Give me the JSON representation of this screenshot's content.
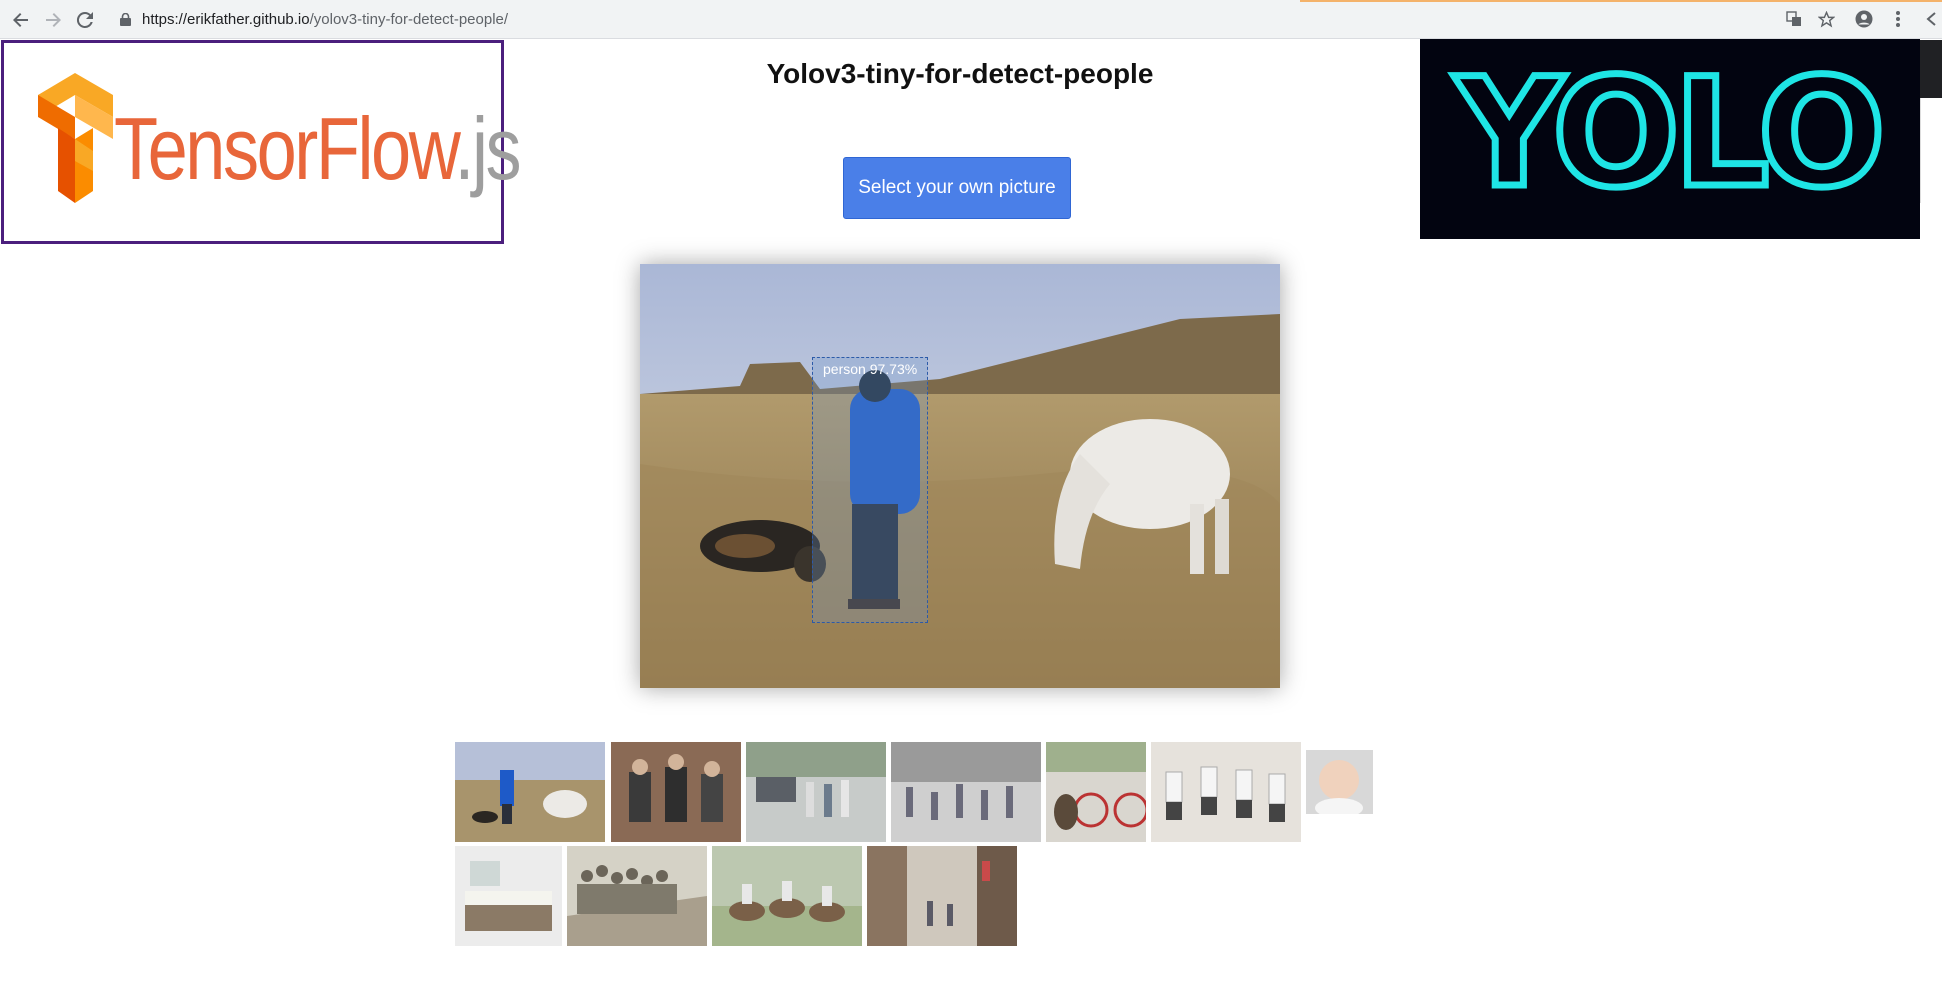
{
  "browser": {
    "url_host": "https://erikfather.github.io",
    "url_path": "/yolov3-tiny-for-detect-people/"
  },
  "page": {
    "title": "Yolov3-tiny-for-detect-people",
    "select_button_label": "Select your own picture",
    "tensorflow_logo": {
      "text_main": "TensorFlow",
      "text_suffix": ".js"
    },
    "yolo_logo": {
      "text": "YOLO"
    }
  },
  "detection": {
    "label": "person 97.73%",
    "class": "person",
    "confidence_percent": 97.73
  },
  "thumbnails": [
    {
      "name": "thumb-man-dog-horse"
    },
    {
      "name": "thumb-three-men-painting"
    },
    {
      "name": "thumb-street-crossing"
    },
    {
      "name": "thumb-crowd-plaza"
    },
    {
      "name": "thumb-dog-bicycle"
    },
    {
      "name": "thumb-jumping-men"
    },
    {
      "name": "thumb-baby"
    },
    {
      "name": "thumb-living-room"
    },
    {
      "name": "thumb-crowded-train"
    },
    {
      "name": "thumb-horse-riders"
    },
    {
      "name": "thumb-shopping-street"
    }
  ],
  "colors": {
    "button_bg": "#4a7fe8",
    "tensorflow_orange": "#e8663a",
    "yolo_cyan": "#1ee5e5",
    "bbox_border": "#2c5aa8"
  }
}
